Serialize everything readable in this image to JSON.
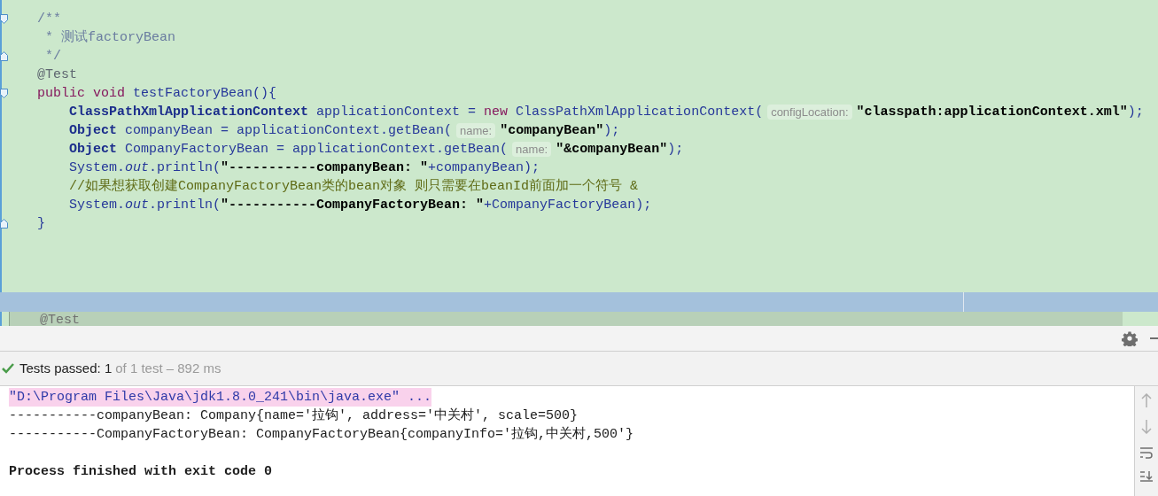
{
  "editor": {
    "lines": [
      {
        "kind": "fold_start",
        "segments": [
          {
            "kind": "doc",
            "text": "/**"
          }
        ]
      },
      {
        "segments": [
          {
            "kind": "doc",
            "text": " * 测试factoryBean"
          }
        ]
      },
      {
        "kind": "fold_end",
        "segments": [
          {
            "kind": "doc",
            "text": " */"
          }
        ]
      },
      {
        "segments": [
          {
            "kind": "annotation",
            "text": "@Test"
          }
        ]
      },
      {
        "kind": "fold_start",
        "segments": [
          {
            "kind": "keyword",
            "text": "public void"
          },
          {
            "kind": "ident",
            "text": "testFactoryBean(){"
          }
        ],
        "children": [
          {
            "segments": [
              {
                "kind": "type",
                "text": "ClassPathXmlApplicationContext"
              },
              {
                "kind": "ident",
                "text": "applicationContext ="
              },
              {
                "kind": "keyword",
                "text": "new"
              },
              {
                "kind": "ident",
                "text": "ClassPathXmlApplicationContext("
              },
              {
                "kind": "hint",
                "text": "configLocation:"
              },
              {
                "kind": "string",
                "text": "\"classpath:applicationContext.xml\""
              },
              {
                "kind": "ident",
                "text": ");"
              }
            ]
          },
          {
            "segments": [
              {
                "kind": "type",
                "text": "Object"
              },
              {
                "kind": "ident",
                "text": "companyBean = applicationContext.getBean("
              },
              {
                "kind": "hint",
                "text": "name:"
              },
              {
                "kind": "string",
                "text": "\"companyBean\""
              },
              {
                "kind": "ident",
                "text": ");"
              }
            ]
          },
          {
            "segments": [
              {
                "kind": "type",
                "text": "Object"
              },
              {
                "kind": "ident",
                "text": "CompanyFactoryBean = applicationContext.getBean("
              },
              {
                "kind": "hint",
                "text": "name:"
              },
              {
                "kind": "string",
                "text": "\"&companyBean\""
              },
              {
                "kind": "ident",
                "text": ");"
              }
            ]
          },
          {
            "segments": [
              {
                "kind": "ident",
                "text": "System."
              },
              {
                "kind": "field",
                "text": "out"
              },
              {
                "kind": "ident",
                "text": ".println("
              },
              {
                "kind": "string",
                "text": "\"-----------companyBean: \""
              },
              {
                "kind": "ident",
                "text": "+companyBean);"
              }
            ]
          },
          {
            "segments": [
              {
                "kind": "comment",
                "text": "//如果想获取创建CompanyFactoryBean类的bean对象 则只需要在beanId前面加一个符号 &"
              }
            ]
          },
          {
            "segments": [
              {
                "kind": "ident",
                "text": "System."
              },
              {
                "kind": "field",
                "text": "out"
              },
              {
                "kind": "ident",
                "text": ".println("
              },
              {
                "kind": "string",
                "text": "\"-----------CompanyFactoryBean: \""
              },
              {
                "kind": "ident",
                "text": "+CompanyFactoryBean);"
              }
            ]
          }
        ]
      },
      {
        "kind": "fold_end",
        "segments": [
          {
            "kind": "ident",
            "text": "}"
          }
        ]
      }
    ],
    "next_line": "@Test"
  },
  "test_status": {
    "passed": "Tests passed: 1",
    "detail": "of 1 test – 892 ms"
  },
  "console": {
    "lines": [
      {
        "kind": "command",
        "text": "\"D:\\Program Files\\Java\\jdk1.8.0_241\\bin\\java.exe\" ..."
      },
      {
        "kind": "output",
        "text": "-----------companyBean: Company{name='拉钩', address='中关村', scale=500}"
      },
      {
        "kind": "output",
        "text": "-----------CompanyFactoryBean: CompanyFactoryBean{companyInfo='拉钩,中关村,500'}"
      },
      {
        "kind": "exit",
        "text": "Process finished with exit code 0"
      }
    ]
  }
}
